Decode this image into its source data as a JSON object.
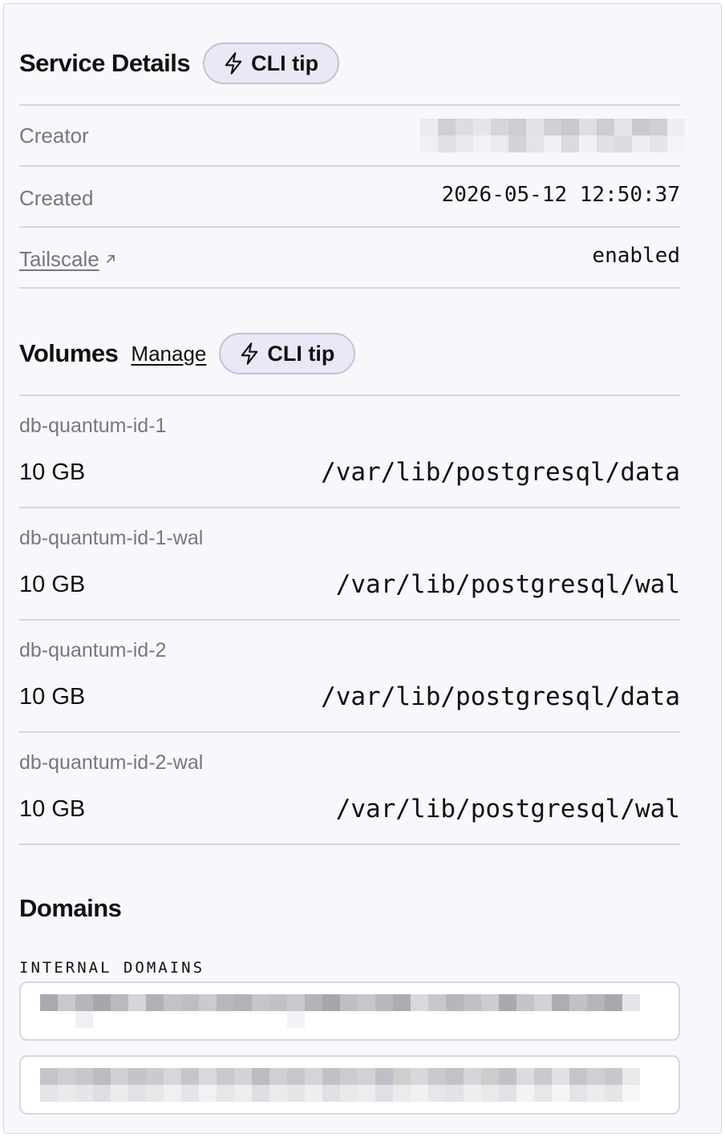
{
  "service_details": {
    "title": "Service Details",
    "cli_tip_label": "CLI tip",
    "rows": {
      "creator_label": "Creator",
      "created_label": "Created",
      "created_value": "2026-05-12 12:50:37",
      "tailscale_label": "Tailscale",
      "tailscale_value": "enabled"
    }
  },
  "volumes": {
    "title": "Volumes",
    "manage_label": "Manage",
    "cli_tip_label": "CLI tip",
    "items": [
      {
        "name": "db-quantum-id-1",
        "size": "10 GB",
        "path": "/var/lib/postgresql/data"
      },
      {
        "name": "db-quantum-id-1-wal",
        "size": "10 GB",
        "path": "/var/lib/postgresql/wal"
      },
      {
        "name": "db-quantum-id-2",
        "size": "10 GB",
        "path": "/var/lib/postgresql/data"
      },
      {
        "name": "db-quantum-id-2-wal",
        "size": "10 GB",
        "path": "/var/lib/postgresql/wal"
      }
    ]
  },
  "domains": {
    "title": "Domains",
    "internal_label": "INTERNAL DOMAINS"
  },
  "icons": {
    "cli_tip": "lightning-bolt-icon",
    "external_link": "arrow-up-right-icon"
  },
  "colors": {
    "panel_bg": "#f7f7fc",
    "pill_bg": "#e8e8f6",
    "pill_border": "#c3c3d6",
    "muted_text": "#77777f",
    "divider": "#d6d6de"
  }
}
